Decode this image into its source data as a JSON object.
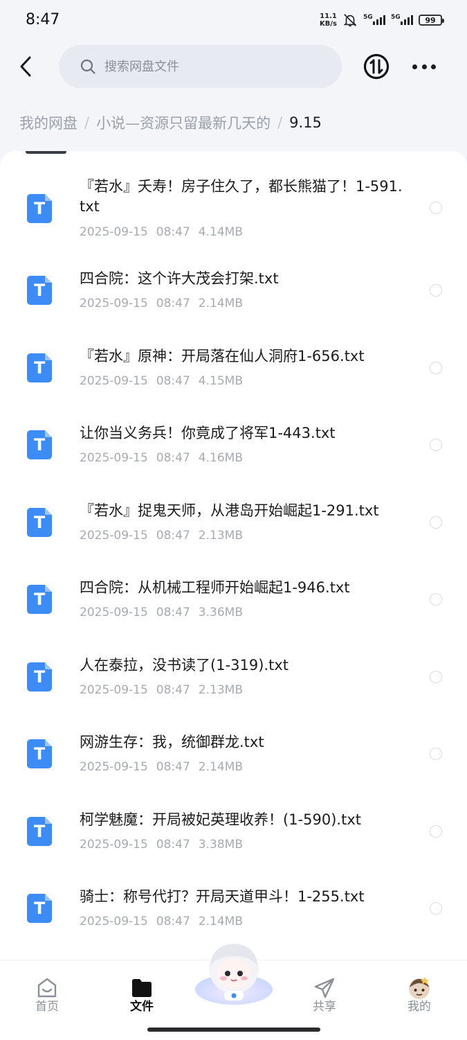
{
  "status_bar": {
    "time": "8:47",
    "net_speed_value": "11.1",
    "net_speed_unit": "KB/s",
    "signal1_label": "5G",
    "signal2_label": "5G",
    "battery": "99"
  },
  "search": {
    "placeholder": "搜索网盘文件"
  },
  "breadcrumb": {
    "items": [
      "我的网盘",
      "小说—资源只留最新几天的",
      "9.15"
    ]
  },
  "files": [
    {
      "name": "『若水』夭寿！房子住久了，都长熊猫了！1-591.txt",
      "date": "2025-09-15",
      "time": "08:47",
      "size": "4.14MB"
    },
    {
      "name": "四合院：这个许大茂会打架.txt",
      "date": "2025-09-15",
      "time": "08:47",
      "size": "2.14MB"
    },
    {
      "name": "『若水』原神：开局落在仙人洞府1-656.txt",
      "date": "2025-09-15",
      "time": "08:47",
      "size": "4.15MB"
    },
    {
      "name": "让你当义务兵！你竟成了将军1-443.txt",
      "date": "2025-09-15",
      "time": "08:47",
      "size": "4.16MB"
    },
    {
      "name": "『若水』捉鬼天师，从港岛开始崛起1-291.txt",
      "date": "2025-09-15",
      "time": "08:47",
      "size": "2.13MB"
    },
    {
      "name": "四合院：从机械工程师开始崛起1-946.txt",
      "date": "2025-09-15",
      "time": "08:47",
      "size": "3.36MB"
    },
    {
      "name": "人在泰拉，没书读了(1-319).txt",
      "date": "2025-09-15",
      "time": "08:47",
      "size": "2.13MB"
    },
    {
      "name": "网游生存：我，统御群龙.txt",
      "date": "2025-09-15",
      "time": "08:47",
      "size": "2.14MB"
    },
    {
      "name": "柯学魅魔：开局被妃英理收养！(1-590).txt",
      "date": "2025-09-15",
      "time": "08:47",
      "size": "3.38MB"
    },
    {
      "name": "骑士：称号代打？开局天道甲斗！1-255.txt",
      "date": "2025-09-15",
      "time": "08:47",
      "size": "2.14MB"
    }
  ],
  "file_icon_letter": "T",
  "nav": {
    "home": "首页",
    "files": "文件",
    "share": "共享",
    "mine": "我的"
  },
  "colors": {
    "accent": "#3d8cf5",
    "background": "#f3f5f9"
  }
}
